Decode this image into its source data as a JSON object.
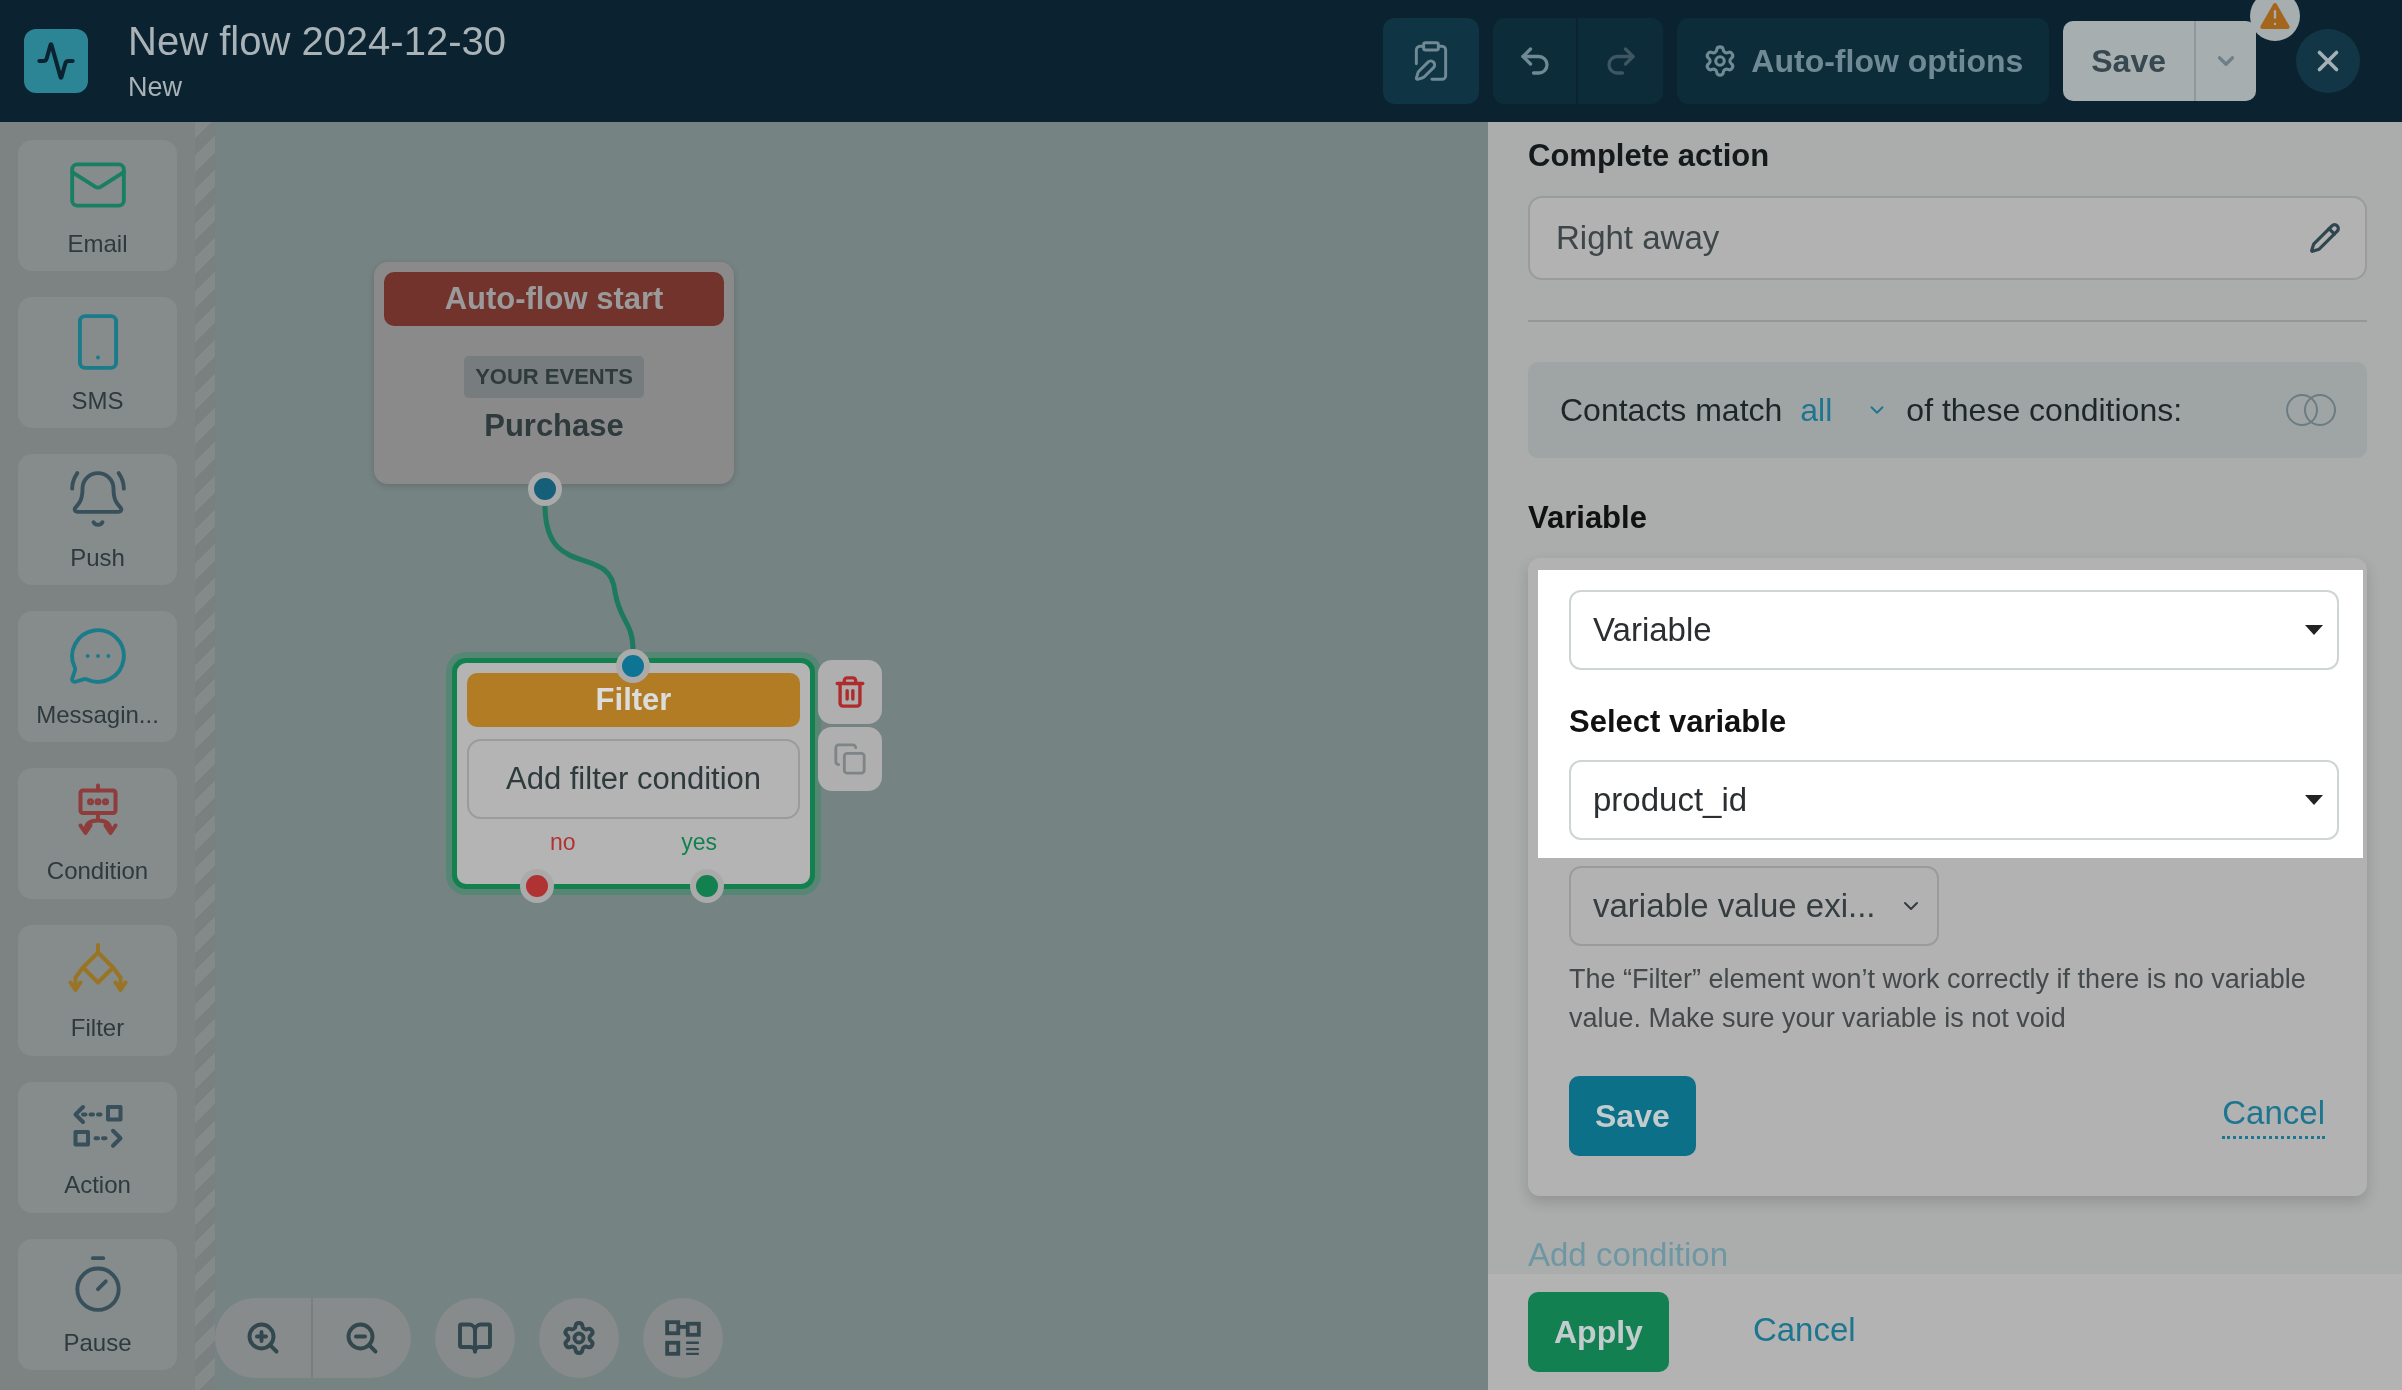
{
  "header": {
    "title": "New flow 2024-12-30",
    "subtitle": "New",
    "options_label": "Auto-flow options",
    "save_label": "Save"
  },
  "sidebar": {
    "items": [
      {
        "label": "Email"
      },
      {
        "label": "SMS"
      },
      {
        "label": "Push"
      },
      {
        "label": "Messagin..."
      },
      {
        "label": "Condition"
      },
      {
        "label": "Filter"
      },
      {
        "label": "Action"
      },
      {
        "label": "Pause"
      }
    ]
  },
  "canvas": {
    "nodes": [
      {
        "kind": "start",
        "title": "Auto-flow start",
        "tag": "YOUR EVENTS",
        "event": "Purchase",
        "selected": false
      },
      {
        "kind": "filter",
        "title": "Filter",
        "action": "Add filter condition",
        "selected": true,
        "branches": [
          {
            "label": "no",
            "color": "#b03232"
          },
          {
            "label": "yes",
            "color": "#13804f"
          }
        ]
      }
    ]
  },
  "panel": {
    "section_title": "Complete action",
    "timing_value": "Right away",
    "match": {
      "prefix": "Contacts match",
      "mode": "all",
      "suffix": "of these conditions:"
    },
    "variable_title": "Variable",
    "condition": {
      "type_value": "Variable",
      "select_label": "Select variable",
      "variable_value": "product_id",
      "operator_value": "variable value exi...",
      "help": "The “Filter” element won’t work correctly if there is no variable value. Make sure your variable is not void",
      "save": "Save",
      "cancel": "Cancel"
    },
    "add_condition": "Add condition",
    "footer": {
      "apply": "Apply",
      "cancel": "Cancel"
    }
  }
}
